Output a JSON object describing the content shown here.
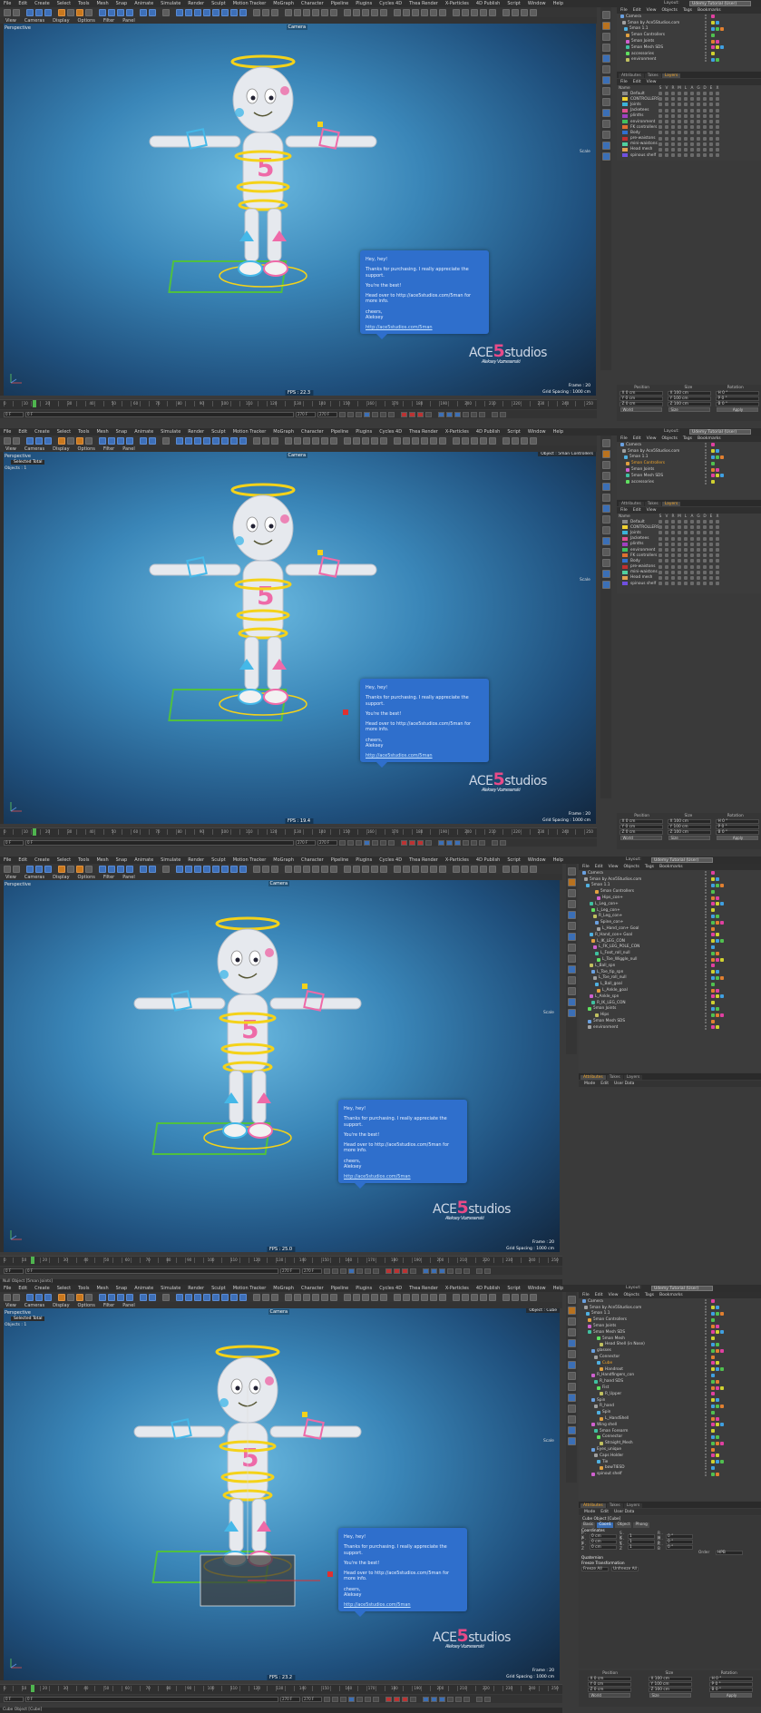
{
  "menu": [
    "File",
    "Edit",
    "Create",
    "Select",
    "Tools",
    "Mesh",
    "Snap",
    "Animate",
    "Simulate",
    "Render",
    "Sculpt",
    "Motion Tracker",
    "MoGraph",
    "Character",
    "Pipeline",
    "Plugins",
    "Cycles 4D",
    "Thea Render",
    "X-Particles",
    "4D Publish",
    "Script",
    "Window",
    "Help"
  ],
  "layout_label": "Layout:",
  "layout_value": "Udemy Tutorial (User)",
  "viewport_menu": [
    "View",
    "Cameras",
    "Display",
    "Options",
    "Filter",
    "Panel"
  ],
  "viewport_label": "Perspective",
  "camera_tag": "Camera",
  "selected_total": "Selected Total",
  "objects_count": "Objects : 1",
  "object_tag_1": "Object : 5man Controllers",
  "object_tag_2": "Object : Cube",
  "status_1": "Null Object [5man Joints]",
  "status_2": "Cube Object [Cube]",
  "scale_label": "Scale",
  "message": {
    "line1": "Hey, hey!",
    "line2": "Thanks for purchasing. I really appreciate the support.",
    "line3": "You're the best!",
    "line4": "Head over to http://ace5studios.com/5man for more info.",
    "line5": "cheers,",
    "line6": "Aleksey",
    "link": "http://ace5studios.com/5man"
  },
  "logo": {
    "pre": "ACE",
    "num": "5",
    "post": "studios",
    "signature": "Aleksey Voznesenski"
  },
  "panels": [
    {
      "fps": "FPS : 22.3",
      "frame": "Frame : 20",
      "grid": "Grid Spacing : 1000 cm"
    },
    {
      "fps": "FPS : 19.4",
      "frame": "Frame : 20",
      "grid": "Grid Spacing : 1000 cm"
    },
    {
      "fps": "FPS : 25.0",
      "frame": "Frame : 20",
      "grid": "Grid Spacing : 1000 cm"
    },
    {
      "fps": "FPS : 23.2",
      "frame": "Frame : 20",
      "grid": "Grid Spacing : 1000 cm"
    }
  ],
  "timeline": {
    "ticks": [
      "0",
      "10",
      "20",
      "30",
      "40",
      "50",
      "60",
      "70",
      "80",
      "90",
      "100",
      "110",
      "120",
      "130",
      "140",
      "150",
      "160",
      "170",
      "180",
      "190",
      "200",
      "210",
      "220",
      "230",
      "240",
      "250"
    ],
    "start": "0 F",
    "current": "0 F",
    "end": "270 F",
    "frame_field": "270 F"
  },
  "object_manager": {
    "menu": [
      "File",
      "Edit",
      "View",
      "Objects",
      "Tags",
      "Bookmarks"
    ],
    "panel1_rows": [
      "Camera",
      "5man by Ace5Studios.com",
      "5man 1.1",
      "5man Controllers",
      "5man Joints",
      "5man Mesh SDS",
      "accessories",
      "environment"
    ],
    "panel2_rows": [
      "Camera",
      "5man by Ace5Studios.com",
      "5man 1.1",
      "5man Controllers",
      "5man Joints",
      "5man Mesh SDS",
      "accessories"
    ],
    "panel3_rows": [
      "Camera",
      "5man by Ace5Studios.com",
      "5man 1.1",
      "5man Controllers",
      "Hips_con+",
      "L_Leg_con+",
      "L_Leg_con+",
      "R_Leg_con+",
      "Spine_con+",
      "L_Hand_con+ Goal",
      "R_Hand_con+ Goal",
      "L_IK_LEG_CON",
      "L_FK_LEG_POLE_CON",
      "L_Foot_roll_null",
      "L_Toe_Wiggle_null",
      "L_Ball_spn",
      "L_Toe_tip_spn",
      "L_Toe_roll_null",
      "L_Ball_goal",
      "L_Ankle_goal",
      "L_Ankle_spn",
      "R_IK_LEG_CON",
      "5man Joints",
      "Hips",
      "5man Mesh SDS",
      "environment"
    ],
    "panel4_rows": [
      "Camera",
      "5man by Ace5Studios.com",
      "5man 1.1",
      "5man Controllers",
      "5man Joints",
      "5man Mesh SDS",
      "5man Mesh",
      "Head Shell (in Nose)",
      "glasses",
      "Connector",
      "Cube",
      "Handroot",
      "R_Handfingers_con",
      "R_hand SDS",
      "Fist",
      "R_Upper",
      "Spin",
      "R_hand",
      "Spin",
      "L_HandShell",
      "Wing shell",
      "5man Forearm",
      "Connector",
      "Straight_Mesh",
      "Eyes_unique",
      "Caps Holder",
      "Tie",
      "bowTIESD",
      "spinout shelf"
    ],
    "selected_panel2": "5man Controllers",
    "selected_panel4": "Cube"
  },
  "tabs": {
    "panel12": [
      "Attributes",
      "Takes",
      "Layers"
    ],
    "panel12_active": "Layers",
    "panel34": [
      "Attributes",
      "Takes",
      "Layers"
    ],
    "panel34_active": "Attributes"
  },
  "layer_manager": {
    "menu": [
      "File",
      "Edit",
      "View"
    ],
    "name_header": "Name",
    "col_headers": [
      "S",
      "V",
      "R",
      "M",
      "L",
      "A",
      "G",
      "D",
      "E",
      "X"
    ],
    "layers": [
      {
        "name": "Default",
        "color": "#8a8a8a"
      },
      {
        "name": "CONTROLLERS",
        "color": "#f0d030"
      },
      {
        "name": "Joints",
        "color": "#3bb3d9"
      },
      {
        "name": "Jacketees",
        "color": "#e05090"
      },
      {
        "name": "plinths",
        "color": "#a040c0"
      },
      {
        "name": "environment",
        "color": "#40c060"
      },
      {
        "name": "FK controllers",
        "color": "#e07030"
      },
      {
        "name": "Body",
        "color": "#3070d0"
      },
      {
        "name": "pre-waistons",
        "color": "#c03030"
      },
      {
        "name": "mini-waistons",
        "color": "#50d0a0"
      },
      {
        "name": "Head mesh",
        "color": "#e0a050"
      },
      {
        "name": "spinous shelf",
        "color": "#7050e0"
      }
    ]
  },
  "attr_manager": {
    "menu": [
      "Mode",
      "Edit",
      "User Data"
    ]
  },
  "cube_props": {
    "title": "Cube Object [Cube]",
    "tabs": [
      "Basic",
      "Coord.",
      "Object",
      "Phong"
    ],
    "active_tab": "Coord.",
    "section1": "Coordinates",
    "rows": [
      {
        "a": "P . X",
        "av": "0 cm",
        "b": "S . X",
        "bv": "1",
        "c": "R . H",
        "cv": "0 °"
      },
      {
        "a": "P . Y",
        "av": "0 cm",
        "b": "S . Y",
        "bv": "1",
        "c": "R . P",
        "cv": "0 °"
      },
      {
        "a": "P . Z",
        "av": "0 cm",
        "b": "S . Z",
        "bv": "1",
        "c": "R . B",
        "cv": "0 °"
      }
    ],
    "order_label": "Order",
    "order_value": "HPB",
    "section2": "Quaternion",
    "section3": "Freeze Transformation",
    "freeze_all": "Freeze All",
    "unfreeze_all": "Unfreeze All"
  },
  "coordinates": {
    "headers": [
      "Position",
      "Size",
      "Rotation"
    ],
    "rows": [
      [
        "X  0 cm",
        "X  100 cm",
        "H  0 °"
      ],
      [
        "Y  0 cm",
        "Y  100 cm",
        "P  0 °"
      ],
      [
        "Z  0 cm",
        "Z  100 cm",
        "B  0 °"
      ]
    ],
    "mode": "World",
    "size_mode": "Size",
    "apply": "Apply"
  },
  "colors": {
    "accent": "#f0a52a",
    "halo": "#f4d21a",
    "pink": "#ee6aa8",
    "cyan": "#45b8e8",
    "green": "#4fb54f",
    "bubble": "#2f6fcc"
  }
}
